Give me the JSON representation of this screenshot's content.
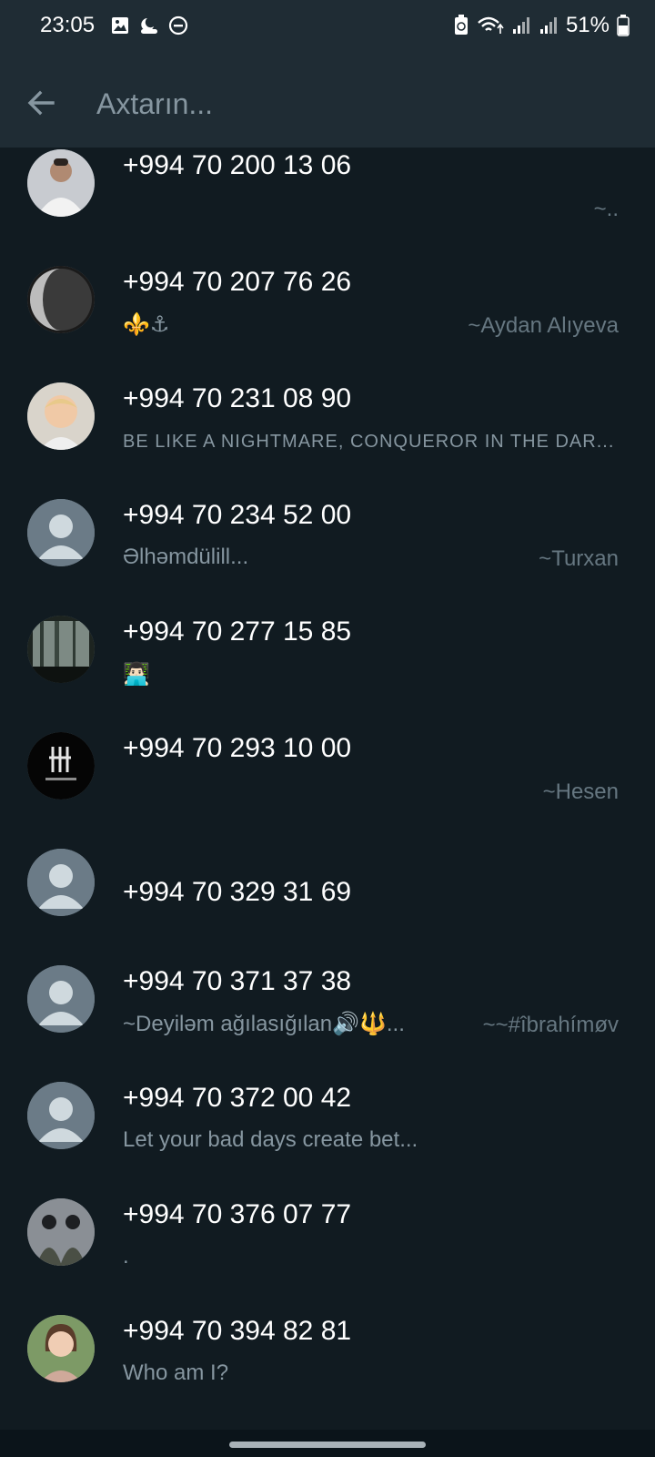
{
  "status_bar": {
    "time": "23:05",
    "left_icons": [
      "image-icon",
      "weather-icon",
      "dnd-icon"
    ],
    "right_icons": [
      "battery-saver-icon",
      "wifi-icon",
      "signal-icon",
      "signal-icon"
    ],
    "battery": "51%"
  },
  "search": {
    "placeholder": "Axtarın..."
  },
  "contacts": [
    {
      "name": "+994 70 200 13 06",
      "status": "",
      "alias": "~..",
      "avatar": "photo-man-white-shirt"
    },
    {
      "name": "+994 70 207 76 26",
      "status": "⚜️⚓",
      "alias": "~Aydan  Alıyeva",
      "avatar": "photo-moon"
    },
    {
      "name": "+994 70 231 08 90",
      "status": "BE LIKE A NIGHTMARE, CONQUEROR IN THE DAR...",
      "alias": "",
      "avatar": "photo-child"
    },
    {
      "name": "+994 70 234 52 00",
      "status": "Əlhəmdülill...",
      "alias": "~Turxan",
      "avatar": "default-avatar"
    },
    {
      "name": "+994 70 277 15 85",
      "status": "👨🏻‍💻",
      "alias": "",
      "avatar": "photo-forest"
    },
    {
      "name": "+994 70 293 10 00",
      "status": "",
      "alias": "~Hesen",
      "avatar": "logo-hesenov"
    },
    {
      "name": "+994 70 329 31 69",
      "status": "",
      "alias": "",
      "avatar": "default-avatar"
    },
    {
      "name": "+994 70 371 37 38",
      "status": "~Deyiləm ağılasığılan🔊🔱...",
      "alias": "~~#îbrahímøv",
      "avatar": "default-avatar"
    },
    {
      "name": "+994 70 372 00 42",
      "status": "Let your bad days  create bet...",
      "alias": "",
      "avatar": "default-avatar"
    },
    {
      "name": "+994 70 376 07 77",
      "status": ".",
      "alias": "",
      "avatar": "photo-soldiers"
    },
    {
      "name": "+994 70 394 82 81",
      "status": "Who am I?",
      "alias": "",
      "avatar": "photo-woman"
    }
  ],
  "colors": {
    "header_bg": "#1f2c34",
    "list_bg": "#111b21",
    "primary_text": "#ffffff",
    "secondary_text": "#8696a0"
  }
}
